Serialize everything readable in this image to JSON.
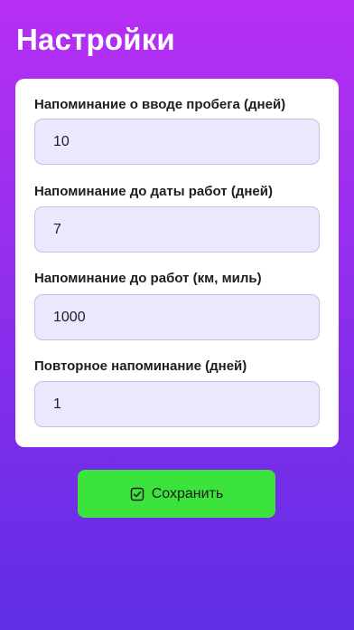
{
  "header": {
    "title": "Настройки"
  },
  "settings": {
    "fields": [
      {
        "label": "Напоминание о вводе пробега (дней)",
        "value": "10"
      },
      {
        "label": "Напоминание до даты работ (дней)",
        "value": "7"
      },
      {
        "label": "Напоминание до работ (км, миль)",
        "value": "1000"
      },
      {
        "label": "Повторное напоминание (дней)",
        "value": "1"
      }
    ]
  },
  "actions": {
    "save_label": "Сохранить",
    "save_icon": "checkbox-checked-icon"
  },
  "colors": {
    "accent_green": "#3be33c",
    "gradient_top": "#b62ff3",
    "gradient_bottom": "#5f2fe6",
    "input_bg": "#e9e8fc"
  }
}
